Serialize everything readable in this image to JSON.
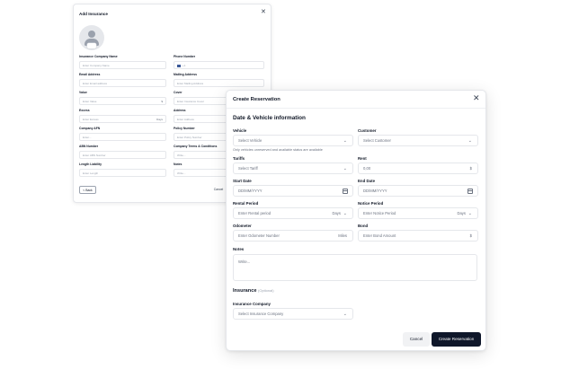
{
  "insurance_modal": {
    "title": "Add Insurance",
    "close": "✕",
    "fields": {
      "company_name": {
        "label": "Insurance Company Name",
        "placeholder": "Enter Company Name"
      },
      "phone": {
        "label": "Phone Number",
        "value": "+1"
      },
      "email": {
        "label": "Email Address",
        "placeholder": "Enter Email address"
      },
      "mailing": {
        "label": "Mailing Address",
        "placeholder": "Enter Mailing Address"
      },
      "value": {
        "label": "Value",
        "placeholder": "Enter Value",
        "suffix": "$"
      },
      "cover": {
        "label": "Cover",
        "placeholder": "Enter Insurance Cover"
      },
      "excess": {
        "label": "Excess",
        "placeholder": "Enter Excess",
        "suffix": "Days"
      },
      "address": {
        "label": "Address",
        "placeholder": "Enter Address"
      },
      "company_afn": {
        "label": "Company AFN",
        "placeholder": "Enter..."
      },
      "policy_number": {
        "label": "Policy Number",
        "placeholder": "Enter Policy Number"
      },
      "abn_number": {
        "label": "ABN Number",
        "placeholder": "Enter ABN Number"
      },
      "terms": {
        "label": "Company Terms & Conditions",
        "placeholder": "Write..."
      },
      "length_liability": {
        "label": "Length Liability",
        "placeholder": "Enter Length"
      },
      "notes": {
        "label": "Notes",
        "placeholder": "Write..."
      }
    },
    "back_label": "< Back",
    "cancel_label": "Cancel"
  },
  "reservation_modal": {
    "title": "Create Reservation",
    "close": "✕",
    "section_title": "Date & Vehicle information",
    "vehicle": {
      "label": "Vehicle",
      "placeholder": "Select Vehicle",
      "hint": "Only vehicles unreserved and available status are available"
    },
    "customer": {
      "label": "Customer",
      "placeholder": "Select Customer"
    },
    "tariffs": {
      "label": "Tariffs",
      "placeholder": "Select Tariff"
    },
    "rent": {
      "label": "Rent",
      "value": "0,00",
      "suffix": "$"
    },
    "start_date": {
      "label": "Start Date",
      "placeholder": "DD/MM/YYYY"
    },
    "end_date": {
      "label": "End Date",
      "placeholder": "DD/MM/YYYY"
    },
    "rental_period": {
      "label": "Rental Period",
      "placeholder": "Enter Rental period",
      "suffix": "Days"
    },
    "notice_period": {
      "label": "Notice Period",
      "placeholder": "Enter Notice Period",
      "suffix": "Days"
    },
    "odometer": {
      "label": "Odometer",
      "placeholder": "Enter Odometer Number",
      "suffix": "Miles"
    },
    "bond": {
      "label": "Bond",
      "placeholder": "Enter Bond Amount",
      "suffix": "$"
    },
    "notes": {
      "label": "Notes",
      "placeholder": "Write..."
    },
    "insurance_section": {
      "title": "Insurance",
      "optional": "(Optional)"
    },
    "insurance_company": {
      "label": "Insurance Company",
      "placeholder": "Select Insurance Company"
    },
    "cancel_label": "Cancel",
    "create_label": "Create Reservation"
  },
  "icons": {
    "chevron": "chevron-down-icon",
    "calendar": "calendar-icon",
    "close": "close-icon",
    "avatar": "avatar-icon"
  },
  "colors": {
    "primary": "#0f172a",
    "border": "#e5e7eb",
    "muted": "#6b7280"
  }
}
